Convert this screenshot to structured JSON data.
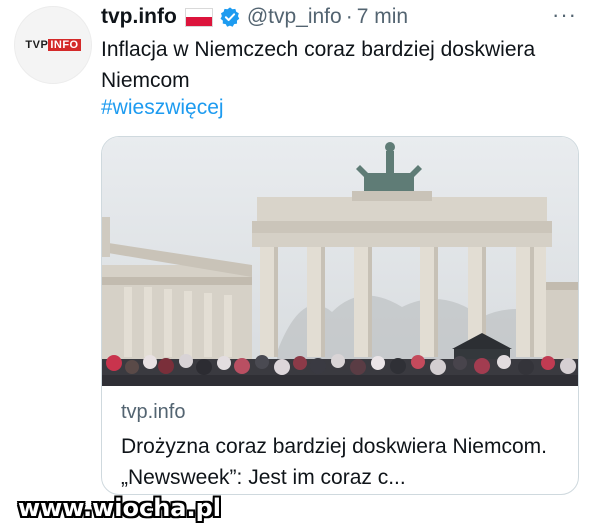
{
  "account": {
    "logo_tvp": "TVP",
    "logo_info": "INFO",
    "name": "tvp.info",
    "handle": "@tvp_info",
    "separator": "·",
    "time": "7 min"
  },
  "menu": {
    "more_label": "···"
  },
  "tweet": {
    "text": "Inflacja w Niemczech coraz bardziej doskwiera Niemcom",
    "hashtag": "#wieszwięcej"
  },
  "card": {
    "domain": "tvp.info",
    "title": "Drożyzna coraz bardziej doskwiera Niemcom. „Newsweek”: Jest im coraz c..."
  },
  "watermark": {
    "text": "www.wiocha.pl"
  },
  "icons": {
    "flag": "poland-flag-icon",
    "verified": "verified-badge-icon",
    "more": "more-options-icon"
  },
  "colors": {
    "link": "#1d9bf0",
    "secondary_text": "#536471",
    "verified": "#1d9bf0",
    "flag_white": "#ffffff",
    "flag_red": "#dc143c"
  }
}
